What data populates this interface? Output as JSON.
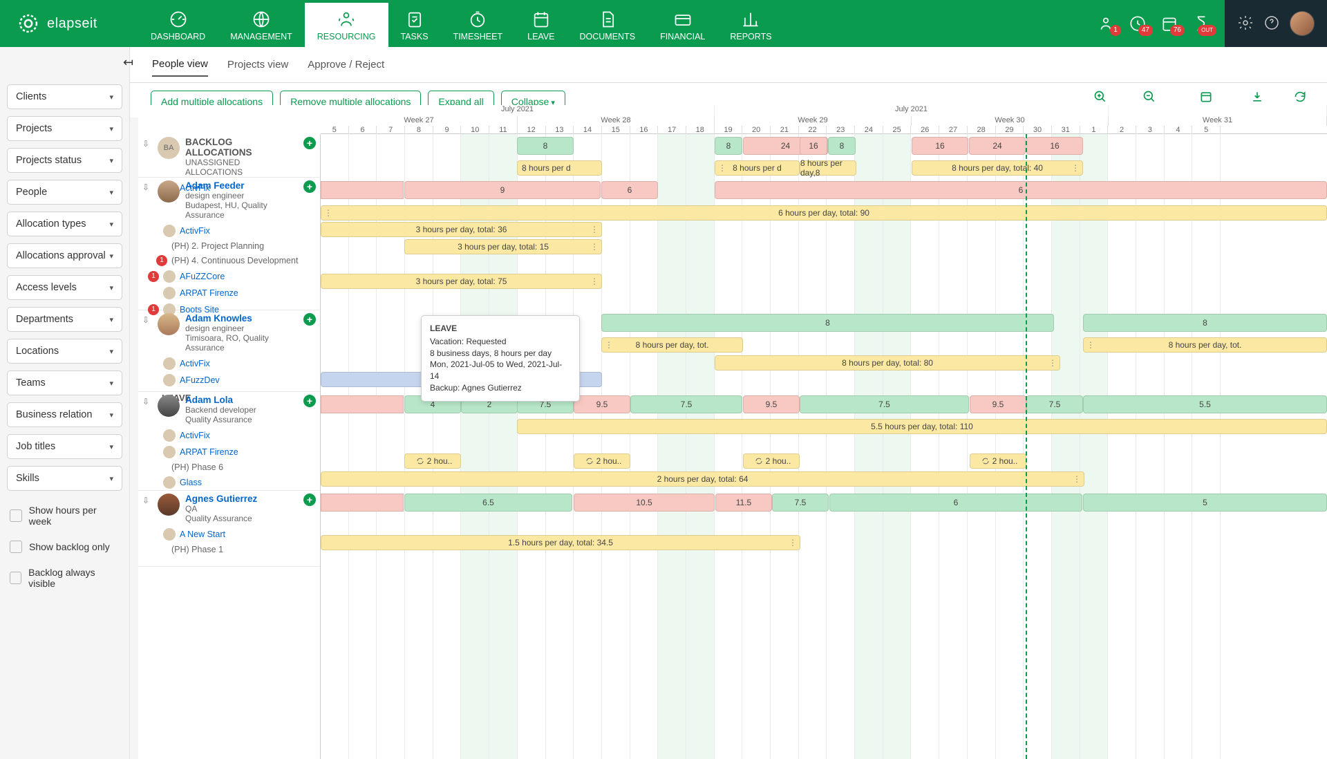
{
  "brand": "elapseit",
  "nav": [
    {
      "label": "DASHBOARD"
    },
    {
      "label": "MANAGEMENT"
    },
    {
      "label": "RESOURCING"
    },
    {
      "label": "TASKS"
    },
    {
      "label": "TIMESHEET"
    },
    {
      "label": "LEAVE"
    },
    {
      "label": "DOCUMENTS"
    },
    {
      "label": "FINANCIAL"
    },
    {
      "label": "REPORTS"
    }
  ],
  "notif": {
    "a": "1",
    "b": "47",
    "c": "76",
    "d": "OUT"
  },
  "subtabs": [
    "People view",
    "Projects view",
    "Approve / Reject"
  ],
  "actions": {
    "addMulti": "Add multiple allocations",
    "removeMulti": "Remove multiple allocations",
    "expand": "Expand all",
    "collapse": "Collapse"
  },
  "zoom": {
    "in": "Zoom in",
    "out": "Zoom out",
    "range": "Zoom range",
    "export": "Export",
    "refresh": "Refresh"
  },
  "filters": [
    "Clients",
    "Projects",
    "Projects status",
    "People",
    "Allocation types",
    "Allocations approval",
    "Access levels",
    "Departments",
    "Locations",
    "Teams",
    "Business relation",
    "Job titles",
    "Skills"
  ],
  "checks": [
    "Show hours per week",
    "Show backlog only",
    "Backlog always visible"
  ],
  "timeline": {
    "month": "July 2021",
    "weeks": [
      "Week 27",
      "Week 28",
      "Week 29",
      "Week 30",
      "Week 31"
    ],
    "days": [
      "5",
      "6",
      "7",
      "8",
      "9",
      "10",
      "11",
      "12",
      "13",
      "14",
      "15",
      "16",
      "17",
      "18",
      "19",
      "20",
      "21",
      "22",
      "23",
      "24",
      "25",
      "26",
      "27",
      "28",
      "29",
      "30",
      "31",
      "1",
      "2",
      "3",
      "4",
      "5"
    ]
  },
  "backlog": {
    "title": "BACKLOG ALLOCATIONS",
    "sub": "UNASSIGNED ALLOCATIONS",
    "avatarLabel": "BA"
  },
  "people": {
    "feeder": {
      "name": "Adam Feeder",
      "role": "design engineer",
      "loc": "Budapest, HU, Quality Assurance",
      "p1": "ActivFix",
      "p2": "(PH) 2. Project Planning",
      "p3": "(PH) 4. Continuous Development",
      "p4": "AFuZZCore",
      "p5": "ARPAT Firenze",
      "p6": "Boots Site"
    },
    "knowles": {
      "name": "Adam Knowles",
      "role": "design engineer",
      "loc": "Timisoara, RO, Quality Assurance",
      "p1": "ActivFix",
      "p2": "AFuzzDev",
      "leave": "LEAVE",
      "vac": "Vacation"
    },
    "lola": {
      "name": "Adam Lola",
      "role": "Backend developer",
      "dept": "Quality Assurance",
      "p1": "ActivFix",
      "p2": "ARPAT Firenze",
      "p3": "(PH) Phase 6",
      "p4": "Glass"
    },
    "gutierrez": {
      "name": "Agnes Gutierrez",
      "role": "QA",
      "dept": "Quality Assurance",
      "p1": "A New Start",
      "p2": "(PH) Phase 1"
    }
  },
  "allocs": {
    "b1": "8",
    "b2": "8",
    "b3": "24",
    "b4": "16",
    "b5": "8",
    "b6": "16",
    "b7": "24",
    "b8": "16",
    "by1": "8 hours per d",
    "by2": "8 hours per d",
    "by3": "8 hours per day,8",
    "by4": "8 hours per day, total: 40",
    "f1": "9",
    "f2": "6",
    "f3": "6",
    "fy1": "3 hours per day, total: 36",
    "fy2": "3 hours per day, total: 15",
    "fy3": "3 hours per day, total: 75",
    "fy4": "6 hours per day, total: 90",
    "k1": "8",
    "k2": "8",
    "ky1": "8 hours per day, tot.",
    "ky2": "8 hours per day, total: 80",
    "ky3": "8 hours per day, tot.",
    "l1": "4",
    "l2": "2",
    "l3": "7.5",
    "l4": "9.5",
    "l5": "7.5",
    "l6": "9.5",
    "l7": "7.5",
    "l8": "9.5",
    "l9": "7.5",
    "l10": "5.5",
    "ly1": "5.5 hours per day, total: 110",
    "ly2": "2 hou..",
    "ly3": "2 hours per day, total: 64",
    "g1": "6.5",
    "g2": "10.5",
    "g3": "11.5",
    "g4": "7.5",
    "g5": "6",
    "g6": "5",
    "gy1": "1.5 hours per day, total: 34.5"
  },
  "tooltip": {
    "title": "LEAVE",
    "l1": "Vacation: Requested",
    "l2": "8 business days, 8 hours per day",
    "l3": "Mon, 2021-Jul-05 to Wed, 2021-Jul-14",
    "l4": "Backup: Agnes Gutierrez"
  }
}
